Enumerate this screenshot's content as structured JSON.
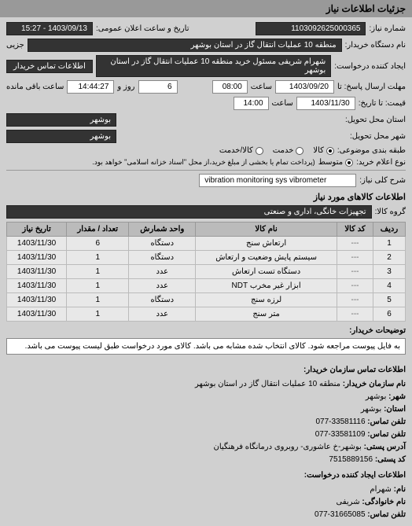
{
  "header": {
    "title": "جزئیات اطلاعات نیاز"
  },
  "top": {
    "need_no_label": "شماره نیاز:",
    "need_no": "1103092625000365",
    "announce_label": "تاریخ و ساعت اعلان عمومی:",
    "announce_value": "1403/09/13 - 15:27",
    "buyer_org_label": "نام دستگاه خریدار:",
    "buyer_org": "منطقه 10 عملیات انتقال گاز در استان بوشهر",
    "partial_label": "جزیی",
    "creator_label": "ایجاد کننده درخواست:",
    "creator": "شهرام شریفی مسئول خرید منطقه 10 عملیات انتقال گاز در استان بوشهر",
    "contact_btn": "اطلاعات تماس خریدار"
  },
  "deadline": {
    "reply_until_label": "مهلت ارسال پاسخ: تا",
    "reply_date": "1403/09/20",
    "time_label": "ساعت",
    "reply_time": "08:00",
    "days_count": "6",
    "days_and": "روز و",
    "countdown": "14:44:27",
    "remaining": "ساعت باقی مانده",
    "price_until_label": "قیمت: تا تاریخ:",
    "price_date": "1403/11/30",
    "price_time": "14:00"
  },
  "delivery": {
    "province_label": "استان محل تحویل:",
    "province": "بوشهر",
    "city_label": "شهر محل تحویل:",
    "city": "بوشهر"
  },
  "classification": {
    "subject_label": "طبقه بندی موضوعی:",
    "opts": [
      "کالا",
      "خدمت",
      "کالا/خدمت"
    ],
    "selected": 0,
    "buy_type_label": "نوع اعلام خرید:",
    "buy_opts": [
      "متوسط"
    ],
    "buy_selected": 0,
    "buy_note": "(پرداخت تمام یا بخشی از مبلغ خرید،از محل \"اسناد خزانه اسلامی\" خواهد بود."
  },
  "need": {
    "desc_label": "شرح کلی نیاز:",
    "desc": "vibration monitoring sys vibrometer"
  },
  "goods": {
    "section_title": "اطلاعات کالاهای مورد نیاز",
    "group_label": "گروه کالا:",
    "group": "تجهیزات خانگی، اداری و صنعتی",
    "headers": [
      "ردیف",
      "کد کالا",
      "نام کالا",
      "واحد شمارش",
      "تعداد / مقدار",
      "تاریخ نیاز"
    ],
    "rows": [
      {
        "idx": "1",
        "code": "---",
        "name": "ارتعاش سنج",
        "unit": "دستگاه",
        "qty": "6",
        "date": "1403/11/30"
      },
      {
        "idx": "2",
        "code": "---",
        "name": "سیستم پایش وضعیت و ارتعاش",
        "unit": "دستگاه",
        "qty": "1",
        "date": "1403/11/30"
      },
      {
        "idx": "3",
        "code": "---",
        "name": "دستگاه تست ارتعاش",
        "unit": "عدد",
        "qty": "1",
        "date": "1403/11/30"
      },
      {
        "idx": "4",
        "code": "---",
        "name": "ابزار غیر مخرب NDT",
        "unit": "عدد",
        "qty": "1",
        "date": "1403/11/30"
      },
      {
        "idx": "5",
        "code": "---",
        "name": "لرزه سنج",
        "unit": "دستگاه",
        "qty": "1",
        "date": "1403/11/30"
      },
      {
        "idx": "6",
        "code": "---",
        "name": "متر سنج",
        "unit": "عدد",
        "qty": "1",
        "date": "1403/11/30"
      }
    ]
  },
  "buyer_note": {
    "label": "توضیحات خریدار:",
    "text": "به فایل پیوست مراجعه شود. کالای انتخاب شده مشابه می باشد. کالای مورد درخواست طبق لیست پیوست می باشد."
  },
  "contact": {
    "org_header": "اطلاعات تماس سازمان خریدار:",
    "org_name_label": "نام سازمان خریدار:",
    "org_name": "منطقه 10 عملیات انتقال گاز در استان بوشهر",
    "city_label": "شهر:",
    "city": "بوشهر",
    "province_label": "استان:",
    "province": "بوشهر",
    "phone_label": "تلفن تماس:",
    "phone": "33581116-077",
    "fax_label": "تلفن تماس:",
    "fax": "33581109-077",
    "address_label": "آدرس پستی:",
    "address": "بوشهر-خ عاشوری- روبروی درمانگاه فرهنگیان",
    "postcode_label": "کد پستی:",
    "postcode": "7515889156",
    "creator_header": "اطلاعات ایجاد کننده درخواست:",
    "fname_label": "نام:",
    "fname": "شهرام",
    "lname_label": "نام خانوادگی:",
    "lname": "شریفی",
    "cphone_label": "تلفن تماس:",
    "cphone": "31665085-077"
  }
}
